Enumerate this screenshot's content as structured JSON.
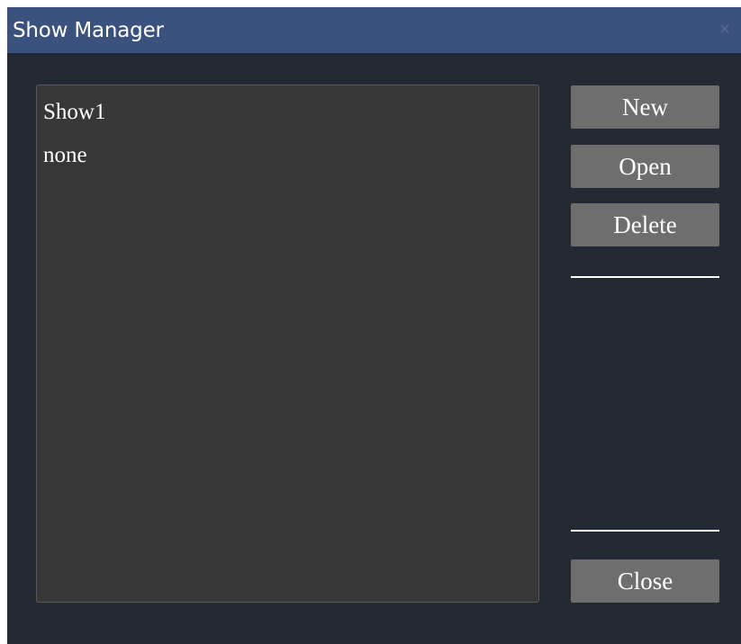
{
  "window": {
    "title": "Show Manager",
    "close_glyph": "×"
  },
  "shows_list": {
    "items": [
      "Show1",
      "none"
    ]
  },
  "buttons": {
    "new_label": "New",
    "open_label": "Open",
    "delete_label": "Delete",
    "close_label": "Close"
  },
  "colors": {
    "titlebar": "#3b527e",
    "window_bg": "#232a33",
    "list_bg": "#373737",
    "button_bg": "#6e6e6e",
    "text": "#ffffff"
  }
}
